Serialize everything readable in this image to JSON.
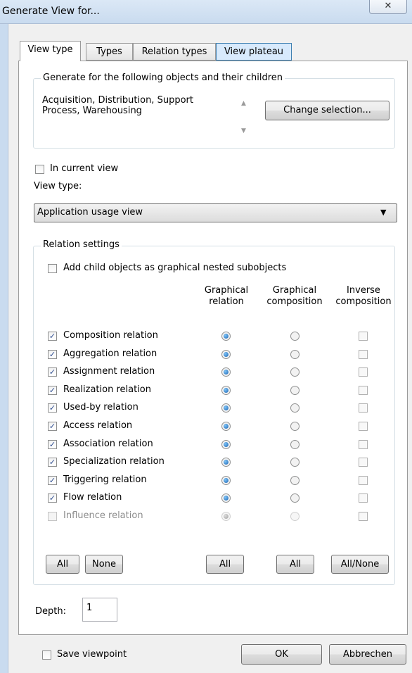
{
  "window": {
    "title": "Generate View for...",
    "close_glyph": "✕"
  },
  "tabs": [
    {
      "label": "View type"
    },
    {
      "label": "Types"
    },
    {
      "label": "Relation types"
    },
    {
      "label": "View plateau"
    }
  ],
  "objects_group": {
    "legend": "Generate for the following objects and their children",
    "objects_line1": "Acquisition, Distribution, Support",
    "objects_line2": "Process, Warehousing",
    "change_button": "Change selection..."
  },
  "in_current_view": {
    "label": "In current view",
    "checked": false
  },
  "view_type": {
    "label": "View type:",
    "selected": "Application usage view"
  },
  "relation_settings": {
    "legend": "Relation settings",
    "add_child_label": "Add child objects as graphical nested subobjects",
    "columns": [
      {
        "line1": "Graphical",
        "line2": "relation"
      },
      {
        "line1": "Graphical",
        "line2": "composition"
      },
      {
        "line1": "Inverse",
        "line2": "composition"
      }
    ],
    "rows": [
      {
        "label": "Composition relation",
        "checked": true,
        "enabled": true
      },
      {
        "label": "Aggregation relation",
        "checked": true,
        "enabled": true
      },
      {
        "label": "Assignment relation",
        "checked": true,
        "enabled": true
      },
      {
        "label": "Realization relation",
        "checked": true,
        "enabled": true
      },
      {
        "label": "Used-by relation",
        "checked": true,
        "enabled": true
      },
      {
        "label": "Access relation",
        "checked": true,
        "enabled": true
      },
      {
        "label": "Association relation",
        "checked": true,
        "enabled": true
      },
      {
        "label": "Specialization relation",
        "checked": true,
        "enabled": true
      },
      {
        "label": "Triggering relation",
        "checked": true,
        "enabled": true
      },
      {
        "label": "Flow relation",
        "checked": true,
        "enabled": true
      },
      {
        "label": "Influence relation",
        "checked": false,
        "enabled": false
      }
    ],
    "buttons": {
      "all": "All",
      "none": "None",
      "all_graphical": "All",
      "all_composition": "All",
      "all_none": "All/None"
    }
  },
  "depth": {
    "label": "Depth:",
    "value": "1"
  },
  "footer": {
    "save_viewpoint": "Save viewpoint",
    "ok": "OK",
    "cancel": "Abbrechen"
  }
}
